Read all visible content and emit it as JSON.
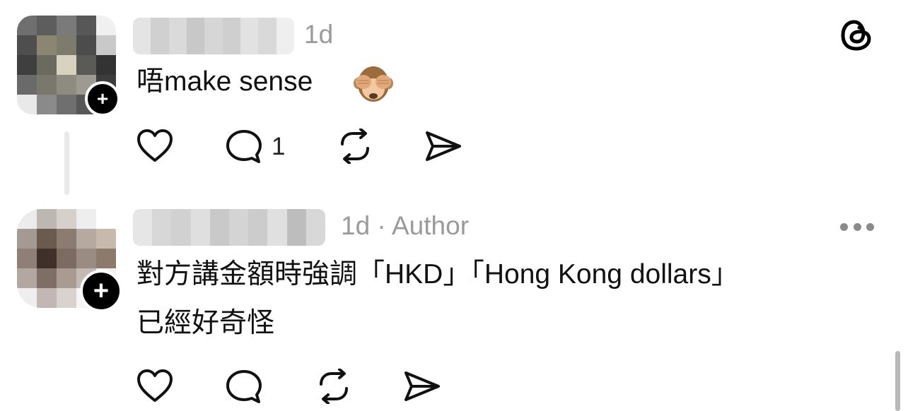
{
  "app": {
    "logo_icon": "threads-logo-icon"
  },
  "comments": [
    {
      "time": "1d",
      "text": "唔make sense",
      "emoji_icon": "see-no-evil-monkey-emoji",
      "follow_badge": "+",
      "actions": {
        "reply_count": "1"
      }
    },
    {
      "time": "1d",
      "separator": " · ",
      "role": "Author",
      "text_line1": "對方講金額時強調「HKD」「Hong Kong dollars」",
      "text_line2": "已經好奇怪",
      "follow_badge": "+",
      "more_icon": "more-options-icon"
    }
  ],
  "colors": {
    "text": "#111111",
    "meta": "#9a9a9a",
    "badge": "#000000",
    "thread_line": "#e9e9e9"
  }
}
